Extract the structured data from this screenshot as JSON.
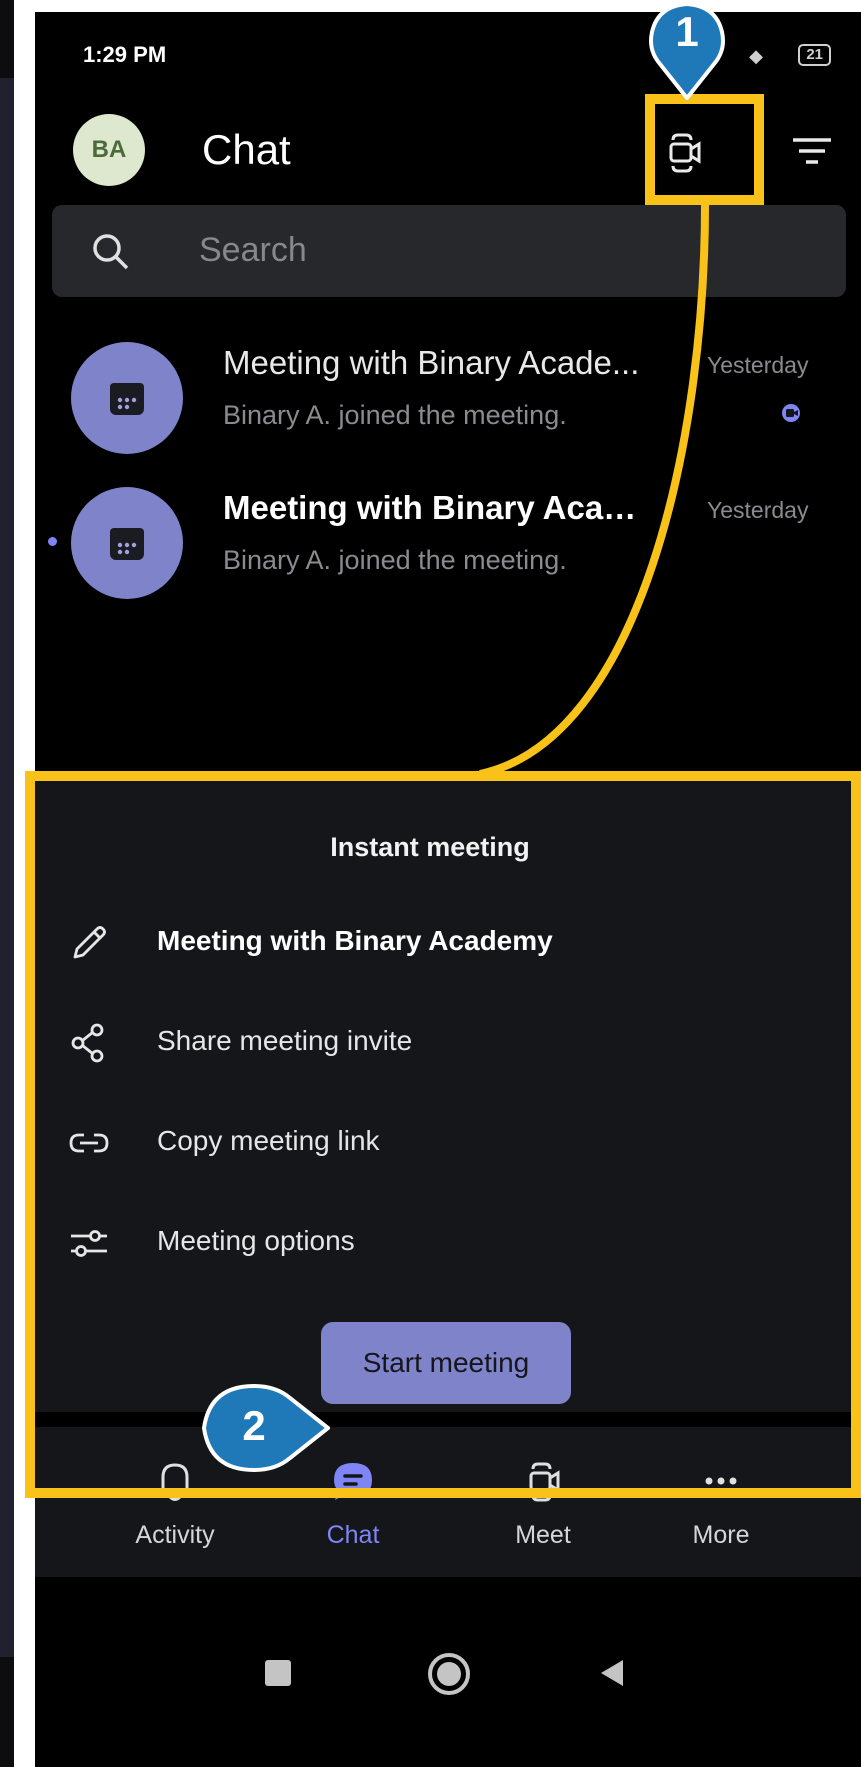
{
  "status_bar": {
    "time": "1:29 PM",
    "battery": "21"
  },
  "header": {
    "avatar_initials": "BA",
    "title": "Chat"
  },
  "search": {
    "placeholder": "Search"
  },
  "chats": [
    {
      "title": "Meeting with Binary Acade...",
      "preview": "Binary A. joined the meeting.",
      "time": "Yesterday",
      "unread": false
    },
    {
      "title": "Meeting with Binary Acade...",
      "preview": "Binary A. joined the meeting.",
      "time": "Yesterday",
      "unread": true
    }
  ],
  "sheet": {
    "title": "Instant meeting",
    "items": [
      {
        "label": "Meeting with Binary Academy",
        "icon": "pencil-icon"
      },
      {
        "label": "Share meeting invite",
        "icon": "share-icon"
      },
      {
        "label": "Copy meeting link",
        "icon": "link-icon"
      },
      {
        "label": "Meeting options",
        "icon": "sliders-icon"
      }
    ],
    "start_label": "Start meeting"
  },
  "bottom_nav": [
    {
      "label": "Activity",
      "icon": "bell-icon",
      "active": false
    },
    {
      "label": "Chat",
      "icon": "chat-icon",
      "active": true
    },
    {
      "label": "Meet",
      "icon": "video-icon",
      "active": false
    },
    {
      "label": "More",
      "icon": "more-icon",
      "active": false
    }
  ],
  "callouts": {
    "first": "1",
    "second": "2"
  },
  "colors": {
    "accent": "#7f85f5",
    "highlight": "#f8c218",
    "callout": "#1f78b7",
    "sheet_bg": "#141619"
  }
}
